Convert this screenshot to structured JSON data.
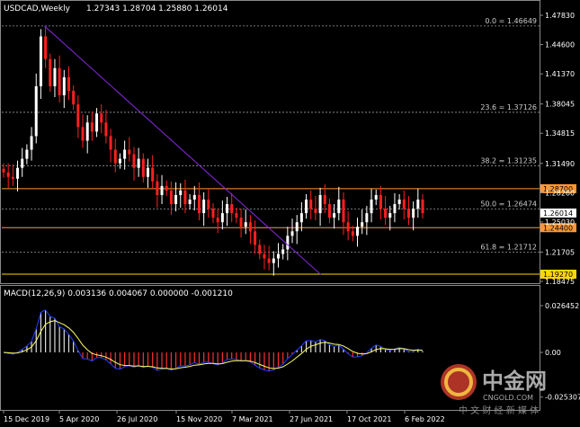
{
  "header": {
    "symbol": "USDCAD,Weekly",
    "ohlc": "1.27343 1.28704 1.25880 1.26014"
  },
  "price_axis": {
    "ticks": [
      "1.47830",
      "1.44600",
      "1.41370",
      "1.38045",
      "1.34815",
      "1.31490",
      "1.28260",
      "1.25030",
      "1.21705",
      "1.18475"
    ]
  },
  "fib_levels": [
    {
      "label": "0.0 = 1.46649",
      "value": 1.46649
    },
    {
      "label": "23.6 = 1.37126",
      "value": 1.37126
    },
    {
      "label": "38.2 = 1.31235",
      "value": 1.31235
    },
    {
      "label": "50.0 = 1.26474",
      "value": 1.26474
    },
    {
      "label": "61.8 = 1.21712",
      "value": 1.21712
    }
  ],
  "horizontal_lines": [
    {
      "label": "1.28700",
      "value": 1.287,
      "color": "#ff9933"
    },
    {
      "label": "1.24400",
      "value": 1.244,
      "color": "#ff9933"
    },
    {
      "label": "1.19270",
      "value": 1.1927,
      "color": "#ffd700"
    }
  ],
  "current_price": {
    "label": "1.26014",
    "value": 1.26014
  },
  "macd": {
    "title": "MACD(12,26,9) 0.003136 0.004067 0.000000 -0.001210",
    "ticks": [
      "0.026452",
      "0.00",
      "-0.025307"
    ]
  },
  "time_axis": {
    "labels": [
      "15 Dec 2019",
      "5 Apr 2020",
      "26 Jul 2020",
      "15 Nov 2020",
      "7 Mar 2021",
      "27 Jun 2021",
      "17 Oct 2021",
      "6 Feb 2022"
    ]
  },
  "watermark": {
    "brand": "中金网",
    "url": "CNGOLD.COM",
    "tagline": "中 文 财 经 新 媒 体"
  },
  "colors": {
    "bull": "#ffffff",
    "bear": "#ff2020",
    "trendline": "#8a2be2",
    "grid": "#8a8a8a",
    "macd_signal": "#ffff66",
    "macd_line": "#2040ff"
  },
  "chart_data": {
    "type": "candlestick",
    "series": [
      {
        "name": "USDCAD",
        "close_path": [
          1.305,
          1.3,
          1.298,
          1.31,
          1.32,
          1.33,
          1.345,
          1.4,
          1.455,
          1.43,
          1.4,
          1.42,
          1.39,
          1.41,
          1.395,
          1.38,
          1.355,
          1.34,
          1.36,
          1.35,
          1.37,
          1.36,
          1.345,
          1.33,
          1.315,
          1.32,
          1.33,
          1.325,
          1.31,
          1.32,
          1.3,
          1.31,
          1.295,
          1.28,
          1.29,
          1.285,
          1.27,
          1.28,
          1.285,
          1.27,
          1.275,
          1.28,
          1.26,
          1.275,
          1.265,
          1.255,
          1.25,
          1.26,
          1.27,
          1.26,
          1.255,
          1.245,
          1.25,
          1.24,
          1.225,
          1.215,
          1.21,
          1.205,
          1.21,
          1.215,
          1.22,
          1.235,
          1.24,
          1.25,
          1.26,
          1.275,
          1.265,
          1.26,
          1.28,
          1.27,
          1.255,
          1.26,
          1.275,
          1.25,
          1.24,
          1.235,
          1.245,
          1.25,
          1.26,
          1.275,
          1.28,
          1.265,
          1.255,
          1.26,
          1.27,
          1.275,
          1.265,
          1.255,
          1.265,
          1.275,
          1.26
        ]
      }
    ],
    "ylim": [
      1.18475,
      1.4783
    ]
  }
}
